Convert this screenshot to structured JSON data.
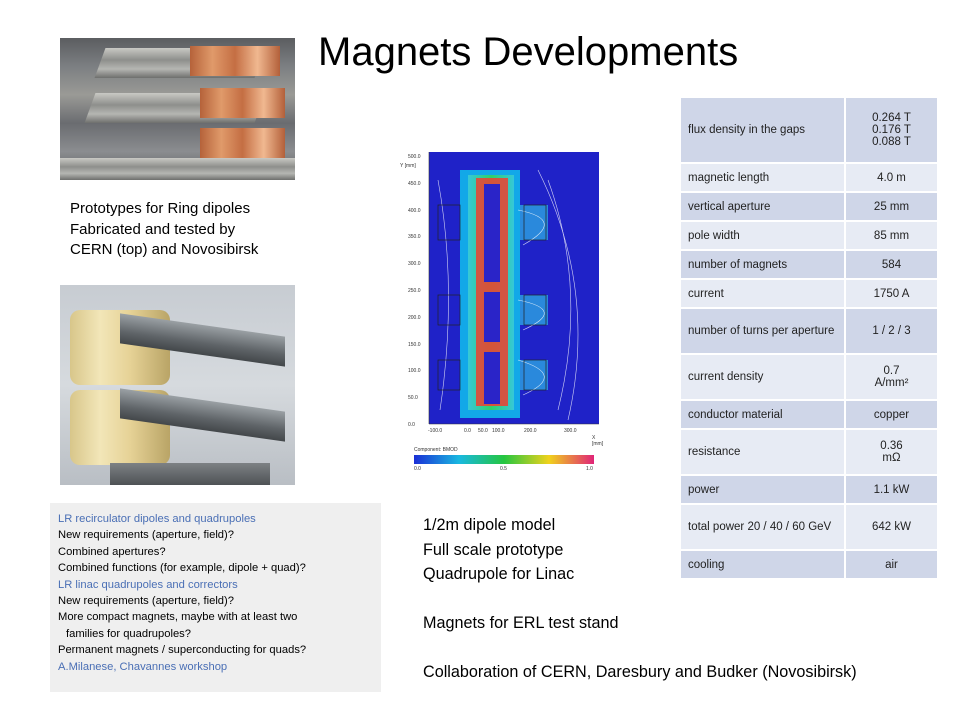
{
  "title": "Magnets Developments",
  "caption": [
    "Prototypes for Ring dipoles",
    "Fabricated and tested by",
    "CERN (top) and Novosibirsk"
  ],
  "notes": [
    {
      "text": "LR recirculator dipoles and quadrupoles",
      "style": "blue"
    },
    {
      "text": "New requirements (aperture, field)?",
      "style": ""
    },
    {
      "text": "Combined apertures?",
      "style": ""
    },
    {
      "text": "Combined functions (for example, dipole + quad)?",
      "style": ""
    },
    {
      "text": "LR linac quadrupoles and correctors",
      "style": "blue"
    },
    {
      "text": "New requirements (aperture, field)?",
      "style": ""
    },
    {
      "text": "More compact magnets, maybe with at least two",
      "style": ""
    },
    {
      "text": "families for quadrupoles?",
      "style": "ind"
    },
    {
      "text": "Permanent magnets / superconducting for quads?",
      "style": ""
    },
    {
      "text": "A.Milanese, Chavannes workshop",
      "style": "blue"
    }
  ],
  "model_lines": [
    "1/2m dipole model",
    "Full scale prototype",
    "Quadrupole for Linac",
    "",
    "Magnets for ERL test stand",
    "",
    "Collaboration of CERN, Daresbury and Budker (Novosibirsk)"
  ],
  "field_map": {
    "y_axis_label": "Y [mm]",
    "x_axis_label": "X [mm]",
    "y_ticks": [
      "500.0",
      "450.0",
      "400.0",
      "350.0",
      "300.0",
      "250.0",
      "200.0",
      "150.0",
      "100.0",
      "50.0",
      "0.0"
    ],
    "x_ticks": [
      "-100.0",
      "0.0",
      "50.0",
      "100.0",
      "200.0",
      "300.0"
    ],
    "component_label": "Component: BMOD",
    "scale_ticks": [
      "0.0",
      "0.5",
      "1.0"
    ]
  },
  "table": [
    {
      "key": "flux density in the gaps",
      "value": "0.264 T\n0.176 T\n0.088 T",
      "h": 66
    },
    {
      "key": "magnetic length",
      "value": "4.0 m",
      "h": 29
    },
    {
      "key": "vertical aperture",
      "value": "25 mm",
      "h": 29
    },
    {
      "key": "pole width",
      "value": "85 mm",
      "h": 29
    },
    {
      "key": "number of magnets",
      "value": "584",
      "h": 29
    },
    {
      "key": "current",
      "value": "1750 A",
      "h": 29
    },
    {
      "key": "number of turns per aperture",
      "value": "1 / 2 / 3",
      "h": 46
    },
    {
      "key": "current density",
      "value": "0.7\nA/mm²",
      "h": 46
    },
    {
      "key": "conductor material",
      "value": "copper",
      "h": 29
    },
    {
      "key": "resistance",
      "value": "0.36\nmΩ",
      "h": 46
    },
    {
      "key": "power",
      "value": "1.1 kW",
      "h": 29
    },
    {
      "key": "total power 20 / 40 / 60 GeV",
      "value": "642 kW",
      "h": 46
    },
    {
      "key": "cooling",
      "value": "air",
      "h": 29
    }
  ]
}
